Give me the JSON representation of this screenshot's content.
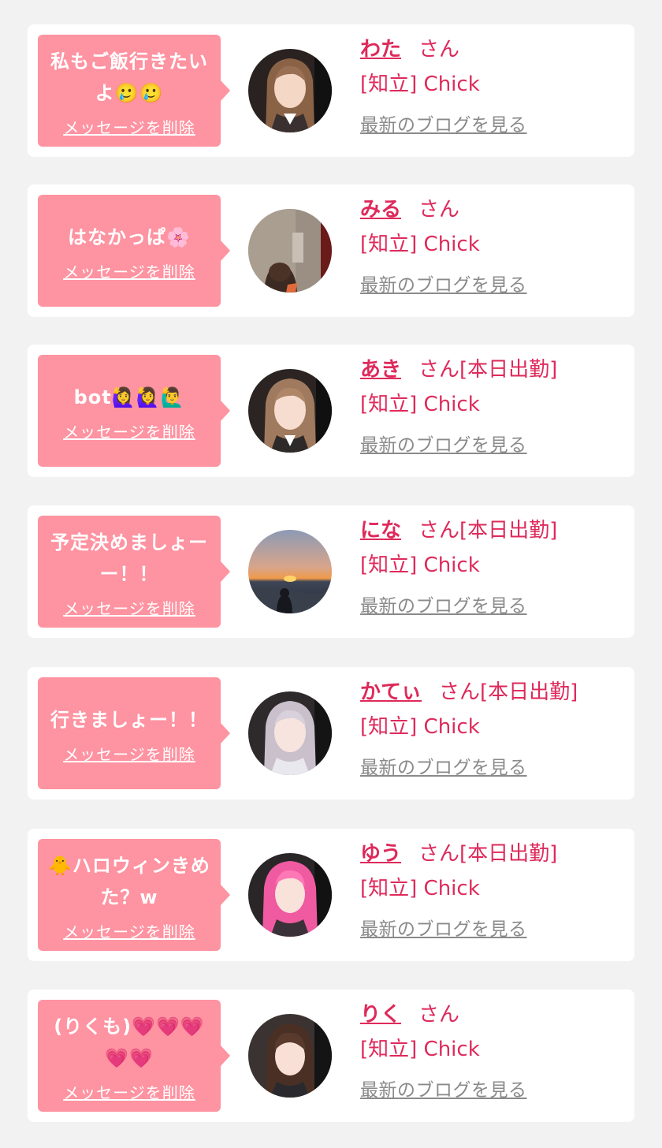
{
  "delete_label": "メッセージを削除",
  "blog_label": "最新のブログを見る",
  "colors": {
    "page_bg": "#f2f2f2",
    "bubble": "#fe93a1",
    "accent": "#de2a5b",
    "link_gray": "#8a8a8a"
  },
  "messages": [
    {
      "message_lines": [
        "私もご飯行きたい",
        "よ🥲🥲"
      ],
      "name": "わた",
      "suffix": "さん",
      "shop": "[知立] Chick",
      "avatar": "girl-selfie-avatar"
    },
    {
      "message_lines": [
        "はなかっぱ🌸"
      ],
      "name": "みる",
      "suffix": "さん",
      "shop": "[知立] Chick",
      "avatar": "room-photo-avatar"
    },
    {
      "message_lines": [
        "bot🙋‍♀️🙋‍♀️🙋‍♂️"
      ],
      "name": "あき",
      "suffix": "さん[本日出勤]",
      "shop": "[知立] Chick",
      "avatar": "girl-selfie-avatar"
    },
    {
      "message_lines": [
        "予定決めましょー",
        "ー！！"
      ],
      "name": "にな",
      "suffix": "さん[本日出勤]",
      "shop": "[知立] Chick",
      "avatar": "sunset-beach-avatar"
    },
    {
      "message_lines": [
        "行きましょー！！"
      ],
      "name": "かてぃ",
      "suffix": "さん[本日出勤]",
      "shop": "[知立] Chick",
      "avatar": "girl-selfie-avatar"
    },
    {
      "message_lines": [
        "🐥ハロウィンきめ",
        "た？w"
      ],
      "name": "ゆう",
      "suffix": "さん[本日出勤]",
      "shop": "[知立] Chick",
      "avatar": "pink-hair-girl-avatar"
    },
    {
      "message_lines": [
        "(りくも)💗💗💗",
        "💗💗"
      ],
      "name": "りく",
      "suffix": "さん",
      "shop": "[知立] Chick",
      "avatar": "girl-selfie-avatar"
    }
  ]
}
